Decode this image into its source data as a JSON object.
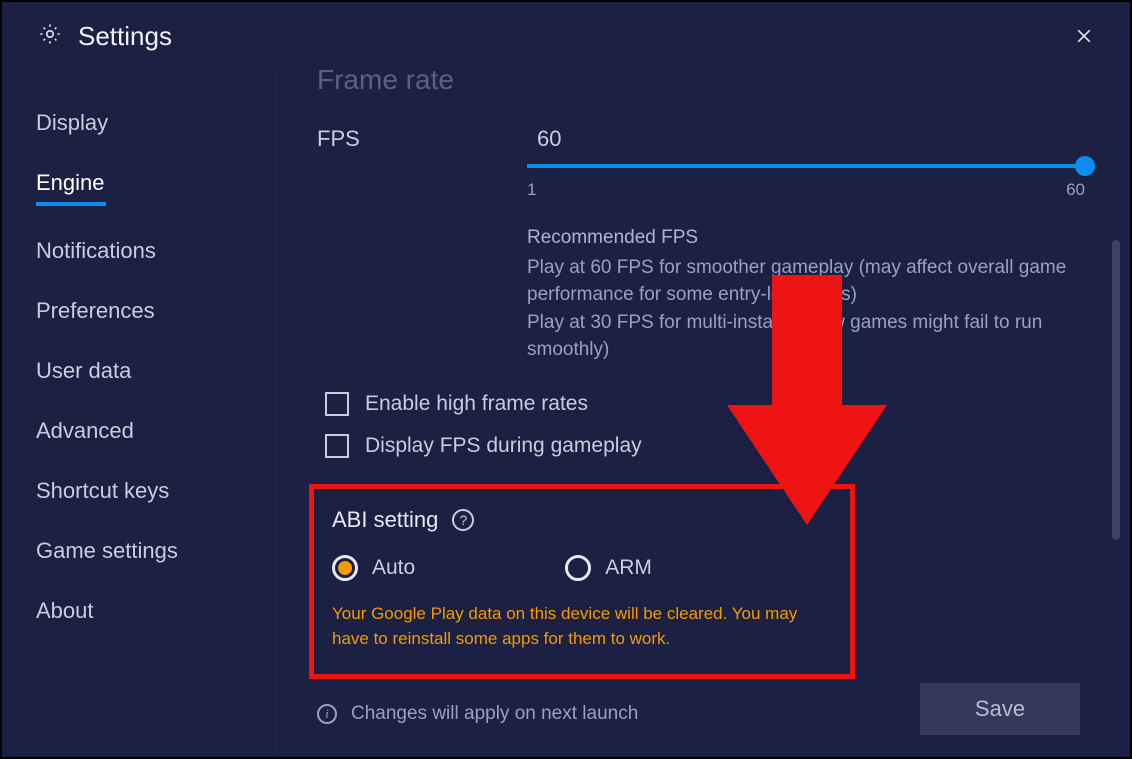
{
  "header": {
    "title": "Settings"
  },
  "sidebar": {
    "items": [
      {
        "label": "Display",
        "active": false
      },
      {
        "label": "Engine",
        "active": true
      },
      {
        "label": "Notifications",
        "active": false
      },
      {
        "label": "Preferences",
        "active": false
      },
      {
        "label": "User data",
        "active": false
      },
      {
        "label": "Advanced",
        "active": false
      },
      {
        "label": "Shortcut keys",
        "active": false
      },
      {
        "label": "Game settings",
        "active": false
      },
      {
        "label": "About",
        "active": false
      }
    ]
  },
  "engine": {
    "frame_rate_title": "Frame rate",
    "fps_label": "FPS",
    "fps_value": "60",
    "slider_min": "1",
    "slider_max": "60",
    "recommended_title": "Recommended FPS",
    "recommended_line1": "Play at 60 FPS for smoother gameplay (may affect overall game performance for some entry-level PC's)",
    "recommended_line2": "Play at 30 FPS for multi-instance (few games might fail to run smoothly)",
    "checkbox_high_fps": "Enable high frame rates",
    "checkbox_display_fps": "Display FPS during gameplay",
    "abi_title": "ABI setting",
    "abi_options": [
      {
        "label": "Auto",
        "selected": true
      },
      {
        "label": "ARM",
        "selected": false
      }
    ],
    "abi_warning": "Your Google Play data on this device will be cleared. You may have to reinstall some apps for them to work.",
    "footer_note": "Changes will apply on next launch",
    "save_label": "Save"
  },
  "colors": {
    "accent": "#0a8ff0",
    "warning": "#f59a00",
    "annotation": "#ef1414"
  }
}
